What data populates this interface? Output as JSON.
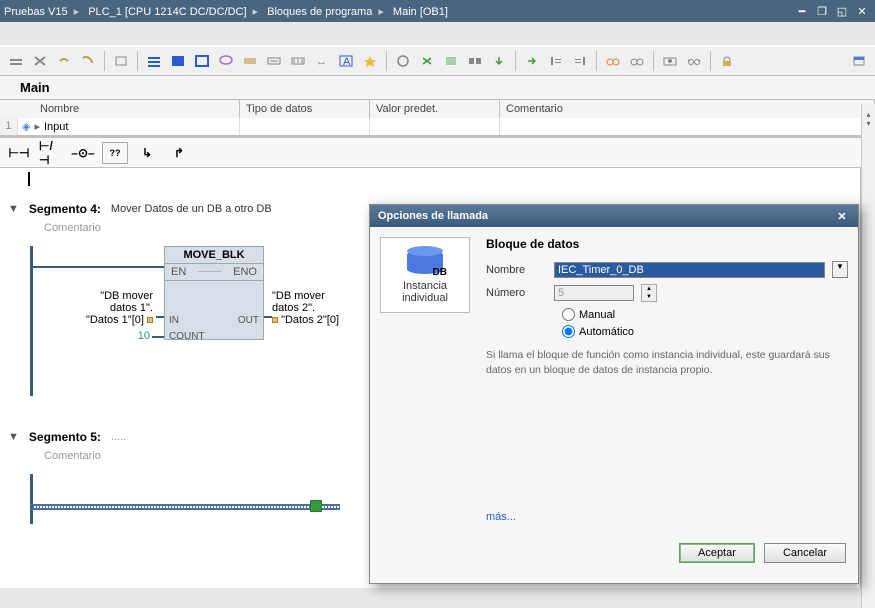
{
  "titlebar": {
    "crumbs": [
      "Pruebas V15",
      "PLC_1 [CPU 1214C DC/DC/DC]",
      "Bloques de programa",
      "Main [OB1]"
    ]
  },
  "main_header": "Main",
  "param_headers": {
    "name": "Nombre",
    "type": "Tipo de datos",
    "valor": "Valor predet.",
    "comentario": "Comentario"
  },
  "param_row": {
    "name": "Input"
  },
  "segment4": {
    "title": "Segmento 4:",
    "desc": "Mover Datos de un DB a otro DB",
    "comment": "Comentario",
    "block": {
      "title": "MOVE_BLK",
      "en": "EN",
      "eno": "ENO",
      "in": "IN",
      "out": "OUT",
      "count": "COUNT",
      "in_tag_l1": "\"DB mover",
      "in_tag_l2": "datos 1\".",
      "in_tag_l3": "\"Datos 1\"[0]",
      "out_tag_l1": "\"DB mover",
      "out_tag_l2": "datos 2\".",
      "out_tag_l3": "\"Datos 2\"[0]",
      "count_val": "10"
    }
  },
  "segment5": {
    "title": "Segmento 5:",
    "desc": ".....",
    "comment": "Comentario"
  },
  "dialog": {
    "title": "Opciones de llamada",
    "instance_label1": "Instancia",
    "instance_label2": "individual",
    "db_label": "DB",
    "section": "Bloque de datos",
    "nombre_lbl": "Nombre",
    "nombre_val": "IEC_Timer_0_DB",
    "numero_lbl": "Número",
    "numero_val": "5",
    "manual": "Manual",
    "auto": "Automático",
    "help": "Si llama el bloque de función como instancia individual, este guardará sus datos en un bloque de datos de instancia propio.",
    "mas": "más...",
    "accept": "Aceptar",
    "cancel": "Cancelar"
  }
}
